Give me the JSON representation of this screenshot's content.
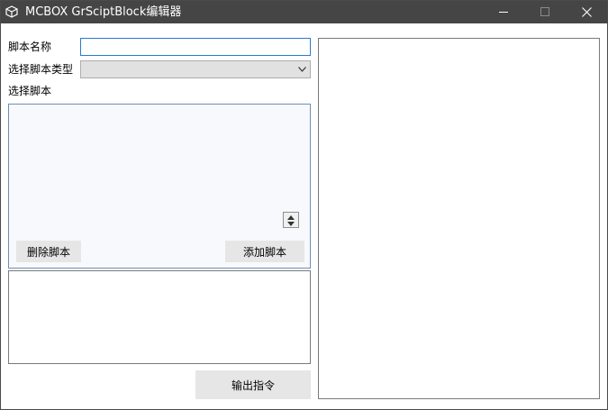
{
  "window": {
    "title": "MCBOX GrSciptBlock编辑器",
    "controls": {
      "minimize": "minimize-icon",
      "maximize": "maximize-icon",
      "close": "close-icon"
    }
  },
  "form": {
    "script_name_label": "脚本名称",
    "script_name_value": "",
    "script_type_label": "选择脚本类型",
    "script_type_value": "",
    "select_script_label": "选择脚本"
  },
  "script_panel": {
    "delete_button": "删除脚本",
    "add_button": "添加脚本"
  },
  "log": {
    "text": ""
  },
  "output_button": "输出指令",
  "output": {
    "text": ""
  },
  "colors": {
    "titlebar": "#454545",
    "input_focus_border": "#2b79d0",
    "button_bg": "#e6e6e6",
    "panel_bg": "#f8f9fc"
  }
}
